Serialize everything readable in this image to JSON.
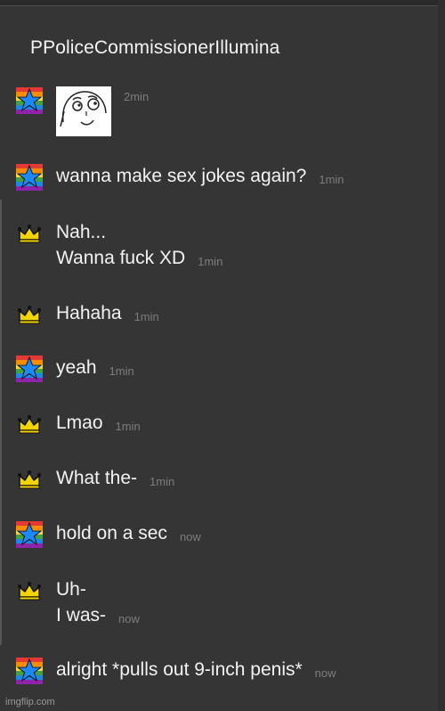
{
  "header": {
    "title": "PPoliceCommissionerIllumina"
  },
  "messages": [
    {
      "author": "star",
      "text": "",
      "time": "2min",
      "image": "meme-face"
    },
    {
      "author": "star",
      "text": "wanna make sex jokes again?",
      "time": "1min"
    },
    {
      "author": "crown",
      "lines": [
        "Nah...",
        "Wanna fuck XD"
      ],
      "time": "1min"
    },
    {
      "author": "crown",
      "text": "Hahaha",
      "time": "1min"
    },
    {
      "author": "star",
      "text": "yeah",
      "time": "1min"
    },
    {
      "author": "crown",
      "text": "Lmao",
      "time": "1min"
    },
    {
      "author": "crown",
      "text": "What the-",
      "time": "1min"
    },
    {
      "author": "star",
      "text": "hold on a sec",
      "time": "now"
    },
    {
      "author": "crown",
      "lines": [
        "Uh-",
        "I was-"
      ],
      "time": "now"
    },
    {
      "author": "star",
      "text": "alright *pulls out 9-inch penis*",
      "time": "now"
    }
  ],
  "watermark": "imgflip.com",
  "colors": {
    "background": "#353535",
    "timestamp": "#7d7d7d",
    "star": "#1e88ff",
    "crown": "#f3d400"
  },
  "icons": {
    "star": "rainbow-star-icon",
    "crown": "yellow-crown-icon"
  }
}
